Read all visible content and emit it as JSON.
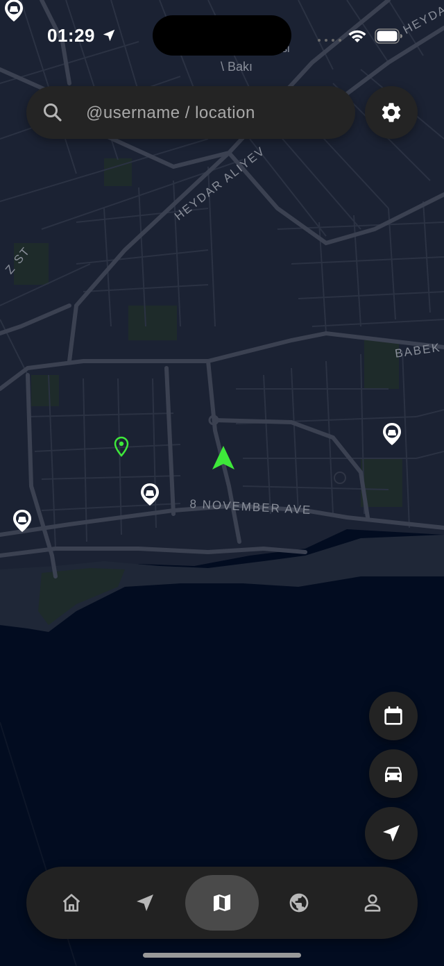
{
  "status_bar": {
    "time": "01:29"
  },
  "search": {
    "placeholder": "@username / location"
  },
  "map": {
    "labels": {
      "baku": "\\ Bakı",
      "heydar_top": "HEYDA",
      "heydar_aliyev": "HEYDAR ALIYEV",
      "babek": "BABEK",
      "st": "Z ST",
      "november": "8 NOVEMBER AVE",
      "partial_si": "si"
    },
    "colors": {
      "land": "#1b2233",
      "water": "#020c20",
      "road": "#363c4c",
      "major_road": "#424857",
      "park": "#1e2b2a",
      "user_marker": "#3ee83a"
    }
  },
  "fabs": [
    {
      "name": "calendar-button",
      "icon": "calendar-icon"
    },
    {
      "name": "car-button",
      "icon": "car-icon"
    },
    {
      "name": "navigate-button",
      "icon": "navigation-arrow-icon"
    }
  ],
  "nav": {
    "items": [
      {
        "name": "home",
        "icon": "home-icon"
      },
      {
        "name": "send",
        "icon": "send-icon"
      },
      {
        "name": "map",
        "icon": "map-icon",
        "active": true
      },
      {
        "name": "explore",
        "icon": "globe-icon"
      },
      {
        "name": "profile",
        "icon": "person-icon"
      }
    ]
  }
}
